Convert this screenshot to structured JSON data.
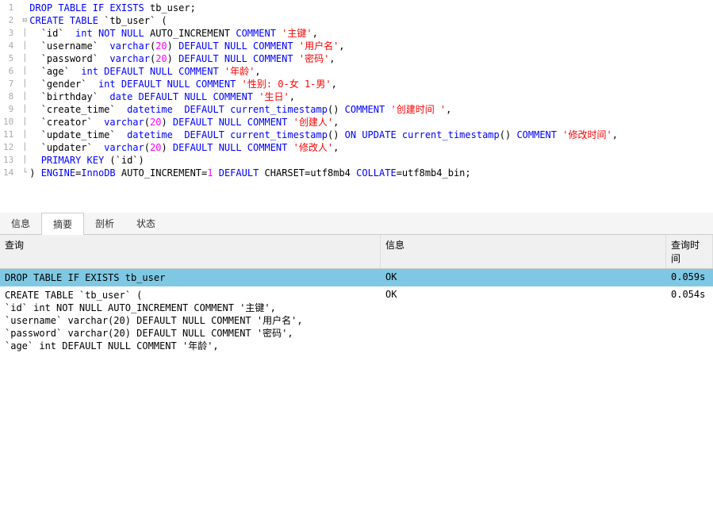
{
  "tabs": {
    "info": "信息",
    "summary": "摘要",
    "profile": "剖析",
    "status": "状态"
  },
  "results": {
    "headers": {
      "query": "查询",
      "info": "信息",
      "time": "查询时间"
    },
    "rows": [
      {
        "query": "DROP TABLE IF EXISTS tb_user",
        "info": "OK",
        "time": "0.059s",
        "selected": true
      },
      {
        "query": "CREATE TABLE `tb_user` (\n`id` int NOT NULL AUTO_INCREMENT COMMENT '主键',\n`username` varchar(20) DEFAULT NULL COMMENT '用户名',\n`password` varchar(20) DEFAULT NULL COMMENT '密码',\n`age` int DEFAULT NULL COMMENT '年龄',",
        "info": "OK",
        "time": "0.054s",
        "selected": false
      }
    ]
  },
  "code": {
    "lines": [
      [
        {
          "t": "DROP TABLE IF",
          "c": "kw"
        },
        {
          "t": " ",
          "c": "plain"
        },
        {
          "t": "EXISTS",
          "c": "kw"
        },
        {
          "t": " tb_user;",
          "c": "plain"
        }
      ],
      [
        {
          "t": "CREATE TABLE",
          "c": "kw"
        },
        {
          "t": " `tb_user` (",
          "c": "plain"
        }
      ],
      [
        {
          "t": "  `id` ",
          "c": "plain"
        },
        {
          "t": " int NOT NULL",
          "c": "kw"
        },
        {
          "t": " AUTO_INCREMENT ",
          "c": "plain"
        },
        {
          "t": "COMMENT",
          "c": "kw"
        },
        {
          "t": " ",
          "c": "plain"
        },
        {
          "t": "'主键'",
          "c": "str"
        },
        {
          "t": ",",
          "c": "plain"
        }
      ],
      [
        {
          "t": "  `username` ",
          "c": "plain"
        },
        {
          "t": " varchar",
          "c": "kw"
        },
        {
          "t": "(",
          "c": "plain"
        },
        {
          "t": "20",
          "c": "num"
        },
        {
          "t": ") ",
          "c": "plain"
        },
        {
          "t": "DEFAULT NULL COMMENT",
          "c": "kw"
        },
        {
          "t": " ",
          "c": "plain"
        },
        {
          "t": "'用户名'",
          "c": "str"
        },
        {
          "t": ",",
          "c": "plain"
        }
      ],
      [
        {
          "t": "  `password` ",
          "c": "plain"
        },
        {
          "t": " varchar",
          "c": "kw"
        },
        {
          "t": "(",
          "c": "plain"
        },
        {
          "t": "20",
          "c": "num"
        },
        {
          "t": ") ",
          "c": "plain"
        },
        {
          "t": "DEFAULT NULL COMMENT",
          "c": "kw"
        },
        {
          "t": " ",
          "c": "plain"
        },
        {
          "t": "'密码'",
          "c": "str"
        },
        {
          "t": ",",
          "c": "plain"
        }
      ],
      [
        {
          "t": "  `age` ",
          "c": "plain"
        },
        {
          "t": " int DEFAULT NULL COMMENT",
          "c": "kw"
        },
        {
          "t": " ",
          "c": "plain"
        },
        {
          "t": "'年龄'",
          "c": "str"
        },
        {
          "t": ",",
          "c": "plain"
        }
      ],
      [
        {
          "t": "  `gender` ",
          "c": "plain"
        },
        {
          "t": " int DEFAULT NULL COMMENT",
          "c": "kw"
        },
        {
          "t": " ",
          "c": "plain"
        },
        {
          "t": "'性别: 0-女 1-男'",
          "c": "str"
        },
        {
          "t": ",",
          "c": "plain"
        }
      ],
      [
        {
          "t": "  `birthday` ",
          "c": "plain"
        },
        {
          "t": " date DEFAULT NULL COMMENT",
          "c": "kw"
        },
        {
          "t": " ",
          "c": "plain"
        },
        {
          "t": "'生日'",
          "c": "str"
        },
        {
          "t": ",",
          "c": "plain"
        }
      ],
      [
        {
          "t": "  `create_time` ",
          "c": "plain"
        },
        {
          "t": " datetime",
          "c": "kw"
        },
        {
          "t": "  ",
          "c": "plain"
        },
        {
          "t": "DEFAULT",
          "c": "kw"
        },
        {
          "t": " ",
          "c": "plain"
        },
        {
          "t": "current_timestamp",
          "c": "kw"
        },
        {
          "t": "() ",
          "c": "plain"
        },
        {
          "t": "COMMENT",
          "c": "kw"
        },
        {
          "t": " ",
          "c": "plain"
        },
        {
          "t": "'创建时间 '",
          "c": "str"
        },
        {
          "t": ",",
          "c": "plain"
        }
      ],
      [
        {
          "t": "  `creator` ",
          "c": "plain"
        },
        {
          "t": " varchar",
          "c": "kw"
        },
        {
          "t": "(",
          "c": "plain"
        },
        {
          "t": "20",
          "c": "num"
        },
        {
          "t": ") ",
          "c": "plain"
        },
        {
          "t": "DEFAULT NULL COMMENT",
          "c": "kw"
        },
        {
          "t": " ",
          "c": "plain"
        },
        {
          "t": "'创建人'",
          "c": "str"
        },
        {
          "t": ",",
          "c": "plain"
        }
      ],
      [
        {
          "t": "  `update_time` ",
          "c": "plain"
        },
        {
          "t": " datetime",
          "c": "kw"
        },
        {
          "t": "  ",
          "c": "plain"
        },
        {
          "t": "DEFAULT",
          "c": "kw"
        },
        {
          "t": " ",
          "c": "plain"
        },
        {
          "t": "current_timestamp",
          "c": "kw"
        },
        {
          "t": "() ",
          "c": "plain"
        },
        {
          "t": "ON UPDATE",
          "c": "kw"
        },
        {
          "t": " ",
          "c": "plain"
        },
        {
          "t": "current_timestamp",
          "c": "kw"
        },
        {
          "t": "() ",
          "c": "plain"
        },
        {
          "t": "COMMENT",
          "c": "kw"
        },
        {
          "t": " ",
          "c": "plain"
        },
        {
          "t": "'修改时间'",
          "c": "str"
        },
        {
          "t": ",",
          "c": "plain"
        }
      ],
      [
        {
          "t": "  `updater` ",
          "c": "plain"
        },
        {
          "t": " varchar",
          "c": "kw"
        },
        {
          "t": "(",
          "c": "plain"
        },
        {
          "t": "20",
          "c": "num"
        },
        {
          "t": ") ",
          "c": "plain"
        },
        {
          "t": "DEFAULT NULL COMMENT",
          "c": "kw"
        },
        {
          "t": " ",
          "c": "plain"
        },
        {
          "t": "'修改人'",
          "c": "str"
        },
        {
          "t": ",",
          "c": "plain"
        }
      ],
      [
        {
          "t": "  ",
          "c": "plain"
        },
        {
          "t": "PRIMARY KEY",
          "c": "kw"
        },
        {
          "t": " (`id`)",
          "c": "plain"
        }
      ],
      [
        {
          "t": ") ",
          "c": "plain"
        },
        {
          "t": "ENGINE",
          "c": "kw"
        },
        {
          "t": "=",
          "c": "plain"
        },
        {
          "t": "InnoDB",
          "c": "kw"
        },
        {
          "t": " AUTO_INCREMENT=",
          "c": "plain"
        },
        {
          "t": "1",
          "c": "num"
        },
        {
          "t": " ",
          "c": "plain"
        },
        {
          "t": "DEFAULT",
          "c": "kw"
        },
        {
          "t": " CHARSET=utf8mb4 ",
          "c": "plain"
        },
        {
          "t": "COLLATE",
          "c": "kw"
        },
        {
          "t": "=utf8mb4_bin;",
          "c": "plain"
        }
      ]
    ]
  }
}
